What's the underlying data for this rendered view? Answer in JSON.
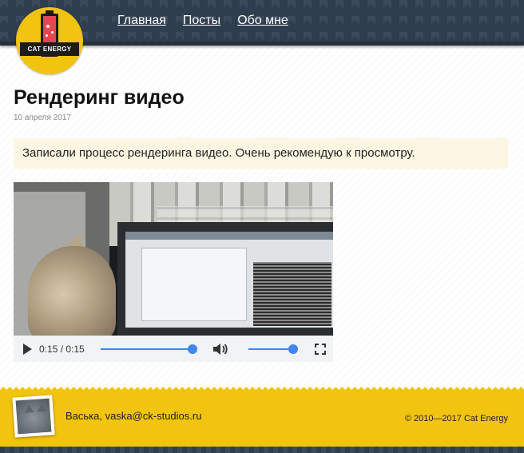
{
  "header": {
    "logo_text": "CAT ENERGY",
    "nav": [
      {
        "label": "Главная"
      },
      {
        "label": "Посты"
      },
      {
        "label": "Обо мне"
      }
    ]
  },
  "post": {
    "title": "Рендеринг видео",
    "date": "10 апреля 2017",
    "intro": "Записали процесс рендеринга видео. Очень рекомендую к просмотру."
  },
  "video": {
    "time_display": "0:15 / 0:15",
    "progress": 1.0,
    "volume": 1.0
  },
  "footer": {
    "author": "Васька, vaska@ck-studios.ru",
    "copyright": "© 2010—2017 Cat Energy"
  },
  "colors": {
    "header_bg": "#2f3e4e",
    "accent_yellow": "#f1c40f",
    "player_blue": "#4285f4"
  }
}
